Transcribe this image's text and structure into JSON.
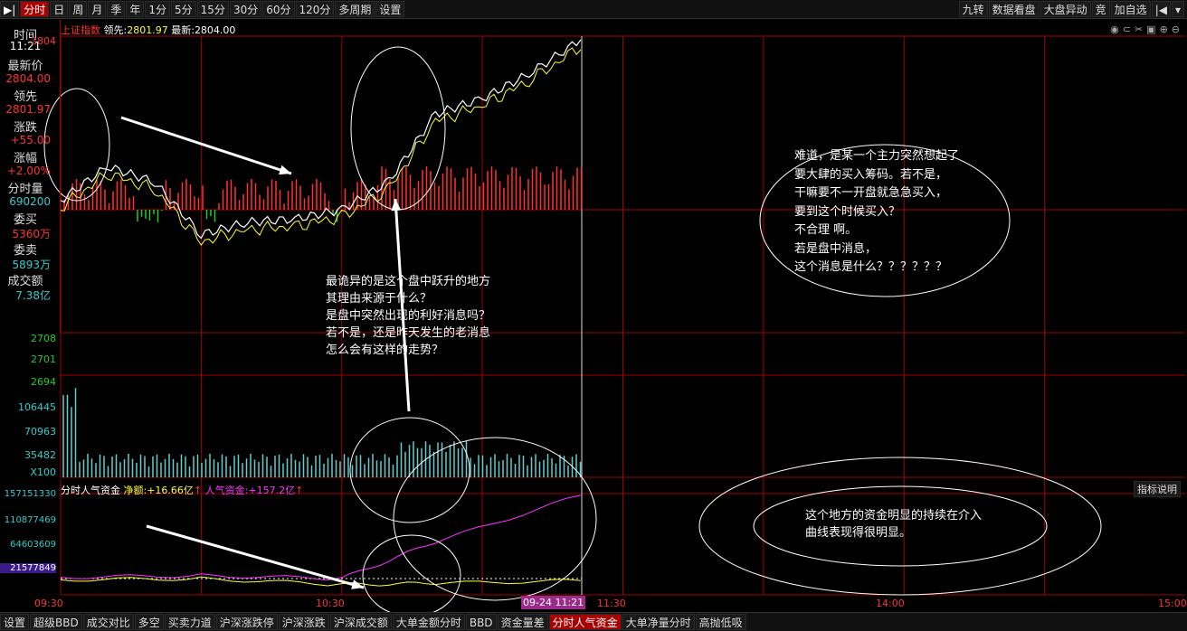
{
  "toolbar": {
    "left": [
      "分时",
      "日",
      "周",
      "月",
      "季",
      "年",
      "1分",
      "5分",
      "15分",
      "30分",
      "60分",
      "120分",
      "多周期",
      "设置"
    ],
    "right": [
      "九转",
      "数据看盘",
      "大盘异动",
      "竞",
      "加自选"
    ]
  },
  "bottom_tabs": [
    "设置",
    "超级BBD",
    "成交对比",
    "多空",
    "买卖力道",
    "沪深涨跌停",
    "沪深涨跌",
    "沪深成交额",
    "大单金额分时",
    "BBD",
    "资金量差",
    "分时人气资金",
    "大单净量分时",
    "高抛低吸"
  ],
  "header": {
    "index_name": "上证指数",
    "lead_label": "领先:",
    "lead_value": "2801.97",
    "latest_label": "最新:",
    "latest_value": "2804.00"
  },
  "left_panel": {
    "time_label": "时间",
    "time": "11:21",
    "price_label": "最新价",
    "price": "2804.00",
    "lead_label": "领先",
    "lead": "2801.97",
    "change_label": "涨跌",
    "change": "+55.00",
    "pct_label": "涨幅",
    "pct": "+2.00%",
    "vol_label": "分时量",
    "vol": "690200",
    "bid_label": "委买",
    "bid": "5360万",
    "ask_label": "委卖",
    "ask": "5893万",
    "amount_label": "成交额",
    "amount": "7.38亿"
  },
  "price_axis": [
    "2804",
    "2708",
    "2701",
    "2694"
  ],
  "volume_axis": [
    "106445",
    "70963",
    "35482",
    "X100"
  ],
  "indicator": {
    "name": "分时人气资金",
    "net_label": "净额:",
    "net": "+16.66亿",
    "pop_label": "人气资金:",
    "pop": "+157.2亿",
    "help": "指标说明"
  },
  "indicator_axis": [
    "157151330",
    "110877469",
    "64603609",
    "21577849"
  ],
  "time_axis": [
    "09:30",
    "10:30",
    "09-24 11:21",
    "11:30",
    "14:00",
    "15:00"
  ],
  "notes": {
    "middle": [
      "最诡异的是这个盘中跃升的地方",
      "其理由来源于什么？",
      "是盘中突然出现的利好消息吗？",
      "若不是，还是昨天发生的老消息",
      "怎么会有这样的走势？"
    ],
    "right": [
      "难道，是某一个主力突然想起了",
      "要大肆的买入筹码。若不是，",
      "干嘛要不一开盘就急急买入，",
      "要到这个时候买入？",
      "不合理 啊。",
      "若是盘中消息，",
      "这个消息是什么？？？？？？"
    ],
    "bottom": [
      "这个地方的资金明显的持续在介入",
      "曲线表现得很明显。"
    ]
  },
  "colors": {
    "up": "#ff3333",
    "down": "#22cc22",
    "price_line": "#ffffff",
    "avg_line": "#ffff33",
    "volume": "#66cccc",
    "pop_line": "#ff33ff",
    "net_line": "#ffff33",
    "grid": "#a00000"
  },
  "chart_data": {
    "type": "line",
    "title": "上证指数",
    "x_range": [
      "09:30",
      "15:00"
    ],
    "series": [
      {
        "name": "最新",
        "x": [
          "09:30",
          "09:40",
          "09:50",
          "10:00",
          "10:10",
          "10:20",
          "10:30",
          "10:40",
          "10:50",
          "11:00",
          "11:10",
          "11:21"
        ],
        "values": [
          2752,
          2763,
          2758,
          2741,
          2745,
          2746,
          2749,
          2758,
          2780,
          2785,
          2793,
          2804
        ]
      }
    ],
    "indicator_series": [
      {
        "name": "人气资金",
        "unit": "亿",
        "x": [
          "09:30",
          "10:00",
          "10:30",
          "10:50",
          "11:21"
        ],
        "values": [
          22,
          25,
          20,
          80,
          157.2
        ]
      },
      {
        "name": "净额",
        "unit": "亿",
        "x": [
          "09:30",
          "10:00",
          "10:30",
          "10:50",
          "11:21"
        ],
        "values": [
          18,
          20,
          10,
          12,
          16.66
        ]
      }
    ]
  }
}
